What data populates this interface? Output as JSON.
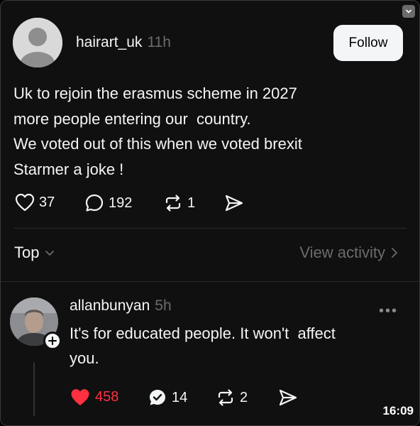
{
  "post": {
    "username": "hairart_uk",
    "time": "11h",
    "follow_label": "Follow",
    "lines": [
      "Uk to rejoin the erasmus scheme in 2027",
      "more people entering our  country.",
      "We voted out of this when we voted brexit",
      "Starmer a joke !"
    ],
    "likes": "37",
    "comments": "192",
    "reposts": "1"
  },
  "replies_header": {
    "sort_label": "Top",
    "view_activity_label": "View activity"
  },
  "comment": {
    "username": "allanbunyan",
    "time": "5h",
    "text_lines": [
      "It's for educated people. It won't  affect",
      "you."
    ],
    "likes": "458",
    "comments": "14",
    "reposts": "2"
  },
  "status": {
    "clock": "16:09"
  },
  "colors": {
    "background": "#101010",
    "text": "#f3f5f7",
    "muted": "#6b6b6b",
    "like_active": "#ff3040"
  }
}
